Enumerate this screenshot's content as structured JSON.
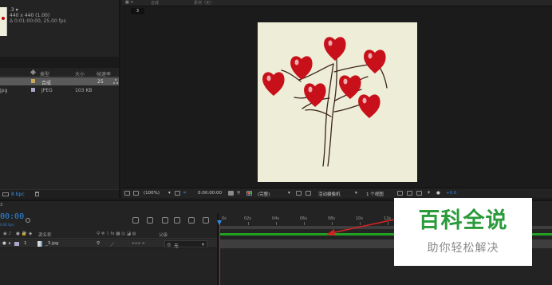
{
  "project": {
    "comp_name": ".3 ▾",
    "comp_dims": "440 x 440 (1.00)",
    "comp_duration": "Δ 0:01:00:00, 25.00 fps",
    "columns": {
      "type": "类型",
      "size": "大小",
      "framerate": "帧速率"
    },
    "rows": [
      {
        "name": "",
        "type": "合成",
        "size": "",
        "framerate": "25",
        "color": "#c8a95a"
      },
      {
        "name": "jpg",
        "type": "JPEG",
        "size": "103 KB",
        "framerate": "",
        "color": "#a9a7c9"
      }
    ],
    "bpc": "8 bpc"
  },
  "viewer": {
    "topbar_left": "合成",
    "topbar_right": "素材（无）",
    "comp_tab": "3",
    "zoom": "(100%)",
    "timecode": "0:00:00:00",
    "resolution": "(完整)",
    "camera": "活动摄像机",
    "views": "1 个视图",
    "exposure": "+0.0"
  },
  "timeline": {
    "tab": "3",
    "timecode": "00:00",
    "fps": "0.00 fps)",
    "headers": {
      "num": "#",
      "source_name": "源名称",
      "parent": "父级"
    },
    "layer": {
      "num": "1",
      "name": "_3.jpg",
      "parent": "无"
    },
    "ruler_ticks": [
      "0s",
      "02s",
      "04s",
      "06s",
      "08s",
      "10s",
      "12s"
    ]
  },
  "watermark": {
    "title": "百科全说",
    "subtitle": "助你轻松解决"
  },
  "colors": {
    "accent": "#2d8ae6",
    "playhead": "#c42020",
    "layer_bar": "#21a021",
    "watermark_green": "#2a9a3a"
  }
}
